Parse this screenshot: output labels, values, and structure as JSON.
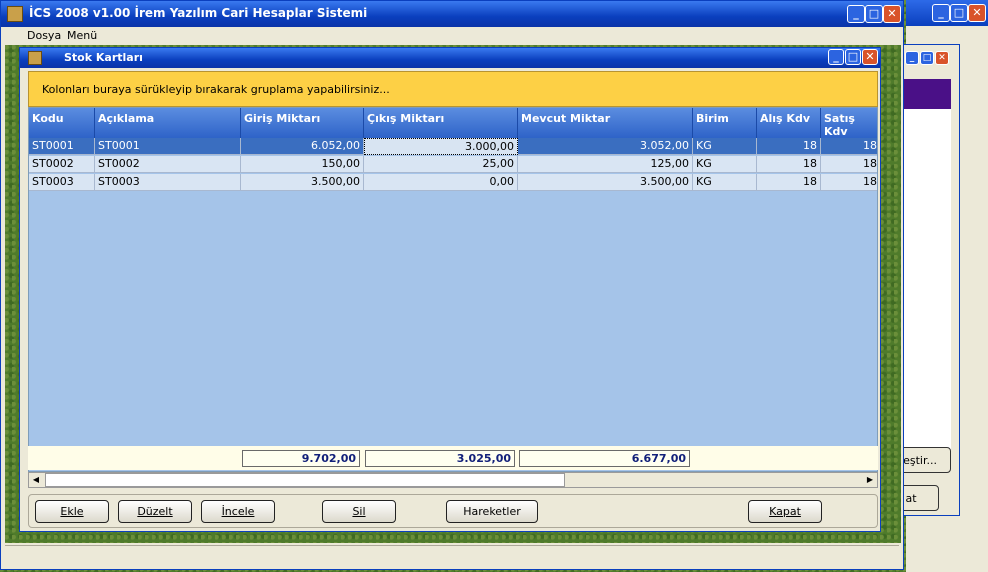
{
  "app": {
    "title": "İCS 2008 v1.00 İrem Yazılım Cari Hesaplar Sistemi",
    "menu": [
      "Dosya",
      "Menü"
    ]
  },
  "back_window": {
    "btn1": "lleştir...",
    "btn2": "at"
  },
  "child": {
    "title": "Stok Kartları",
    "group_hint": "Kolonları buraya sürükleyip bırakarak gruplama yapabilirsiniz...",
    "columns": [
      "Kodu",
      "Açıklama",
      "Giriş Miktarı",
      "Çıkış Miktarı",
      "Mevcut Miktar",
      "Birim",
      "Alış Kdv",
      "Satış Kdv"
    ],
    "rows": [
      [
        "ST0001",
        "ST0001",
        "6.052,00",
        "3.000,00",
        "3.052,00",
        "KG",
        "18",
        "18"
      ],
      [
        "ST0002",
        "ST0002",
        "150,00",
        "25,00",
        "125,00",
        "KG",
        "18",
        "18"
      ],
      [
        "ST0003",
        "ST0003",
        "3.500,00",
        "0,00",
        "3.500,00",
        "KG",
        "18",
        "18"
      ]
    ],
    "totals": {
      "giris": "9.702,00",
      "cikis": "3.025,00",
      "mevcut": "6.677,00"
    },
    "buttons": {
      "ekle": "Ekle",
      "duzelt": "Düzelt",
      "incele": "İncele",
      "sil": "Sil",
      "hareketler": "Hareketler",
      "kapat": "Kapat"
    }
  }
}
